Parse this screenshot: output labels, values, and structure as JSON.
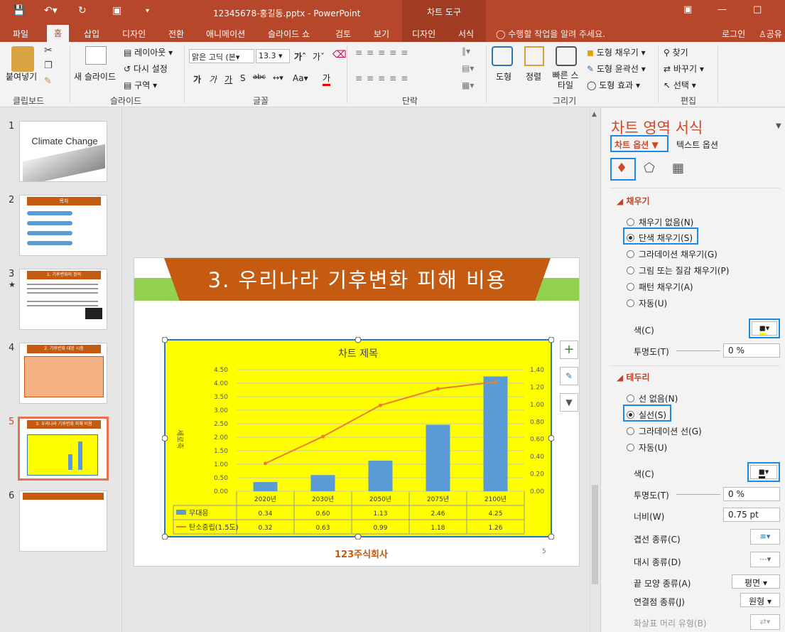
{
  "window": {
    "title": "12345678-홍길동.pptx - PowerPoint",
    "context_title": "차트 도구"
  },
  "tabs": [
    "파일",
    "홈",
    "삽입",
    "디자인",
    "전환",
    "애니메이션",
    "슬라이드 쇼",
    "검토",
    "보기",
    "디자인",
    "서식"
  ],
  "tell_me": "수행할 작업을 알려 주세요.",
  "login": "로그인",
  "share": "공유",
  "ribbon": {
    "paste": "붙여넣기",
    "new_slide": "새 슬라이드",
    "layout": "레이아웃",
    "reset": "다시 설정",
    "section": "구역",
    "font_name": "맑은 고딕 (본",
    "font_size": "13.3",
    "shape": "도형",
    "arrange": "정렬",
    "quick_styles": "빠른 스타일",
    "shape_fill": "도형 채우기",
    "shape_outline": "도형 윤곽선",
    "shape_effects": "도형 효과",
    "find": "찾기",
    "replace": "바꾸기",
    "select": "선택",
    "groups": [
      "클립보드",
      "슬라이드",
      "글꼴",
      "단락",
      "그리기",
      "편집"
    ]
  },
  "thumbnails": [
    {
      "num": "1",
      "title": "Climate Change"
    },
    {
      "num": "2",
      "title": "목차"
    },
    {
      "num": "3",
      "title": "1. 기후변화의 정의"
    },
    {
      "num": "4",
      "title": "2. 기후변화 대응 시점"
    },
    {
      "num": "5",
      "title": "3. 우리나라 기후변화 피해 비용"
    },
    {
      "num": "6",
      "title": ""
    }
  ],
  "slide": {
    "title": "3. 우리나라 기후변화 피해 비용",
    "page_num": "5",
    "logo": "123주식회사"
  },
  "chart_data": {
    "type": "bar",
    "title": "차트 제목",
    "categories": [
      "2020년",
      "2030년",
      "2050년",
      "2075년",
      "2100년"
    ],
    "series": [
      {
        "name": "무대응",
        "type": "bar",
        "axis": "left",
        "values": [
          0.34,
          0.6,
          1.13,
          2.46,
          4.25
        ],
        "color": "#5b9bd5"
      },
      {
        "name": "탄소중립(1.5도)",
        "type": "line",
        "axis": "right",
        "values": [
          0.32,
          0.63,
          0.99,
          1.18,
          1.26
        ],
        "color": "#ed7d31"
      }
    ],
    "ylim_left": [
      0,
      4.5
    ],
    "yticks_left": [
      "0.00",
      "0.50",
      "1.00",
      "1.50",
      "2.00",
      "2.50",
      "3.00",
      "3.50",
      "4.00",
      "4.50"
    ],
    "ylim_right": [
      0,
      1.4
    ],
    "yticks_right": [
      "0.00",
      "0.20",
      "0.40",
      "0.60",
      "0.80",
      "1.00",
      "1.20",
      "1.40"
    ],
    "ylabel": "세로축",
    "table_values": {
      "무대응": [
        "0.34",
        "0.60",
        "1.13",
        "2.46",
        "4.25"
      ],
      "탄소중립(1.5도)": [
        "0.32",
        "0.63",
        "0.99",
        "1.18",
        "1.26"
      ]
    },
    "background": "#ffff00",
    "grid": true,
    "legend": "data-table"
  },
  "pane": {
    "title": "차트 영역 서식",
    "tab_chart": "차트 옵션",
    "tab_text": "텍스트 옵션",
    "fill_section": "채우기",
    "fill_options": [
      "채우기 없음(N)",
      "단색 채우기(S)",
      "그라데이션 채우기(G)",
      "그림 또는 질감 채우기(P)",
      "패턴 채우기(A)",
      "자동(U)"
    ],
    "color_label": "색(C)",
    "transparency_label": "투명도(T)",
    "transparency_value": "0 %",
    "border_section": "테두리",
    "border_options": [
      "선 없음(N)",
      "실선(S)",
      "그라데이션 선(G)",
      "자동(U)"
    ],
    "border_color_label": "색(C)",
    "border_transparency_label": "투명도(T)",
    "border_transparency_value": "0 %",
    "width_label": "너비(W)",
    "width_value": "0.75 pt",
    "compound_label": "겹선 종류(C)",
    "dash_label": "대시 종류(D)",
    "cap_label": "끝 모양 종류(A)",
    "cap_value": "평면",
    "join_label": "연결점 종류(J)",
    "join_value": "원형",
    "arrow_label": "화살표 머리 유형(B)"
  }
}
